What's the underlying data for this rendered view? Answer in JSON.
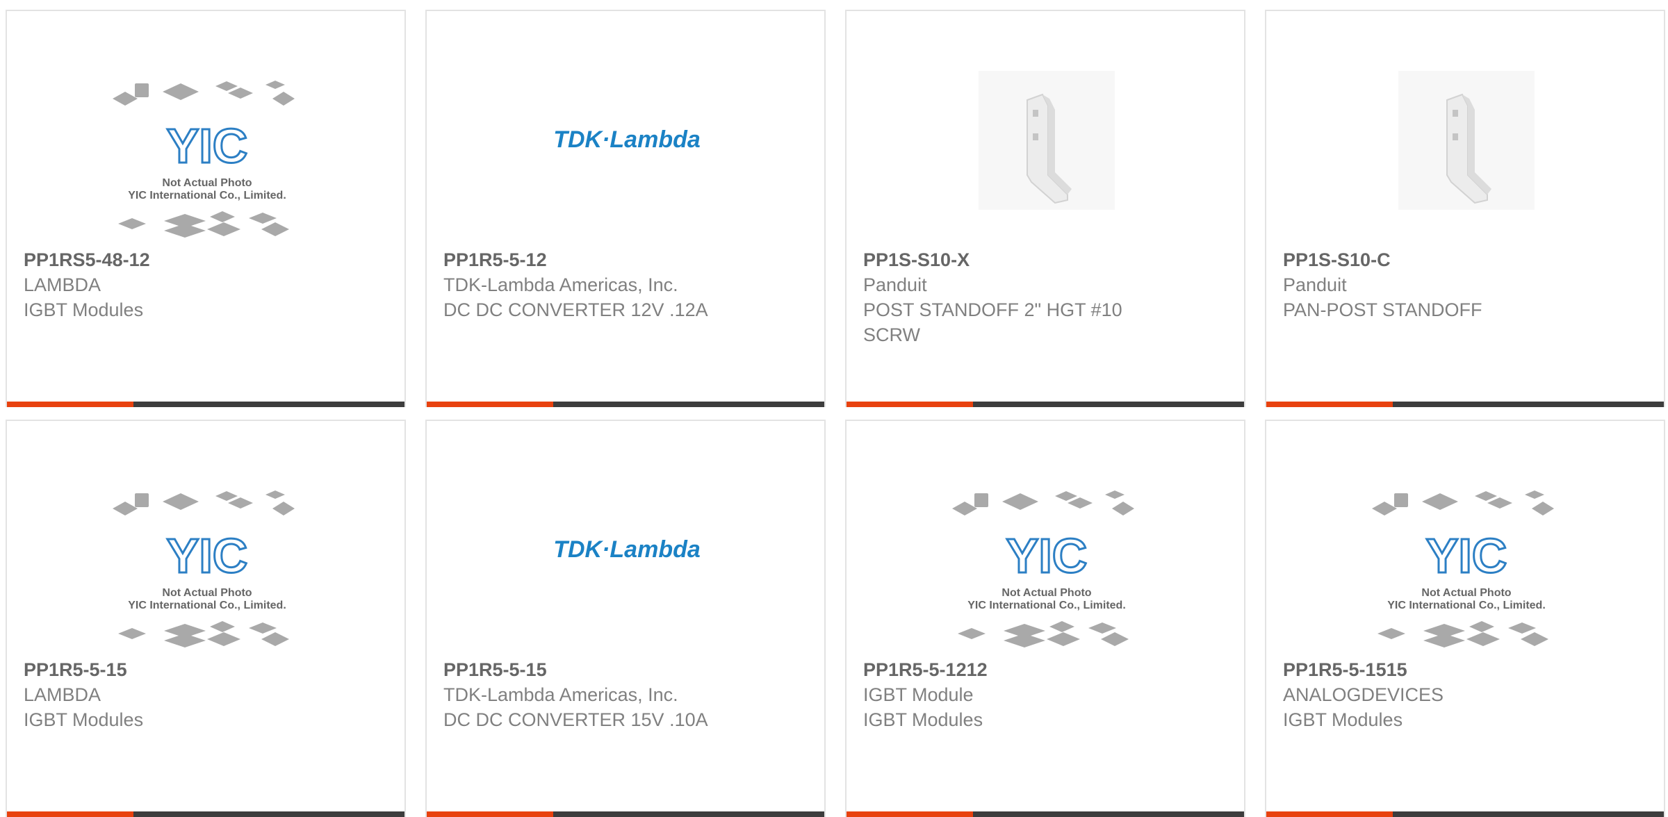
{
  "colors": {
    "accent": "#e8420f",
    "bar": "#3d3d3d",
    "part_number": "#666666",
    "text": "#808080",
    "tdk_blue": "#1b82c5",
    "yic_blue": "#2c7fc4"
  },
  "products": [
    {
      "part_number": "PP1RS5-48-12",
      "manufacturer": "LAMBDA",
      "description": "IGBT Modules",
      "image": "yic-placeholder",
      "image_caption_1": "Not Actual Photo",
      "image_caption_2": "YIC International Co., Limited.",
      "logo_text": "YIC"
    },
    {
      "part_number": "PP1R5-5-12",
      "manufacturer": "TDK-Lambda Americas, Inc.",
      "description": "DC DC CONVERTER 12V .12A",
      "image": "tdk-lambda-logo",
      "logo_text": "TDK·Lambda"
    },
    {
      "part_number": "PP1S-S10-X",
      "manufacturer": "Panduit",
      "description": "POST STANDOFF 2\" HGT #10 SCRW",
      "image": "standoff-bracket-photo"
    },
    {
      "part_number": "PP1S-S10-C",
      "manufacturer": "Panduit",
      "description": "PAN-POST STANDOFF",
      "image": "standoff-bracket-photo"
    },
    {
      "part_number": "PP1R5-5-15",
      "manufacturer": "LAMBDA",
      "description": "IGBT Modules",
      "image": "yic-placeholder",
      "image_caption_1": "Not Actual Photo",
      "image_caption_2": "YIC International Co., Limited.",
      "logo_text": "YIC"
    },
    {
      "part_number": "PP1R5-5-15",
      "manufacturer": "TDK-Lambda Americas, Inc.",
      "description": "DC DC CONVERTER 15V .10A",
      "image": "tdk-lambda-logo",
      "logo_text": "TDK·Lambda"
    },
    {
      "part_number": "PP1R5-5-1212",
      "manufacturer": "IGBT Module",
      "description": "IGBT Modules",
      "image": "yic-placeholder",
      "image_caption_1": "Not Actual Photo",
      "image_caption_2": "YIC International Co., Limited.",
      "logo_text": "YIC"
    },
    {
      "part_number": "PP1R5-5-1515",
      "manufacturer": "ANALOGDEVICES",
      "description": "IGBT Modules",
      "image": "yic-placeholder",
      "image_caption_1": "Not Actual Photo",
      "image_caption_2": "YIC International Co., Limited.",
      "logo_text": "YIC"
    }
  ]
}
